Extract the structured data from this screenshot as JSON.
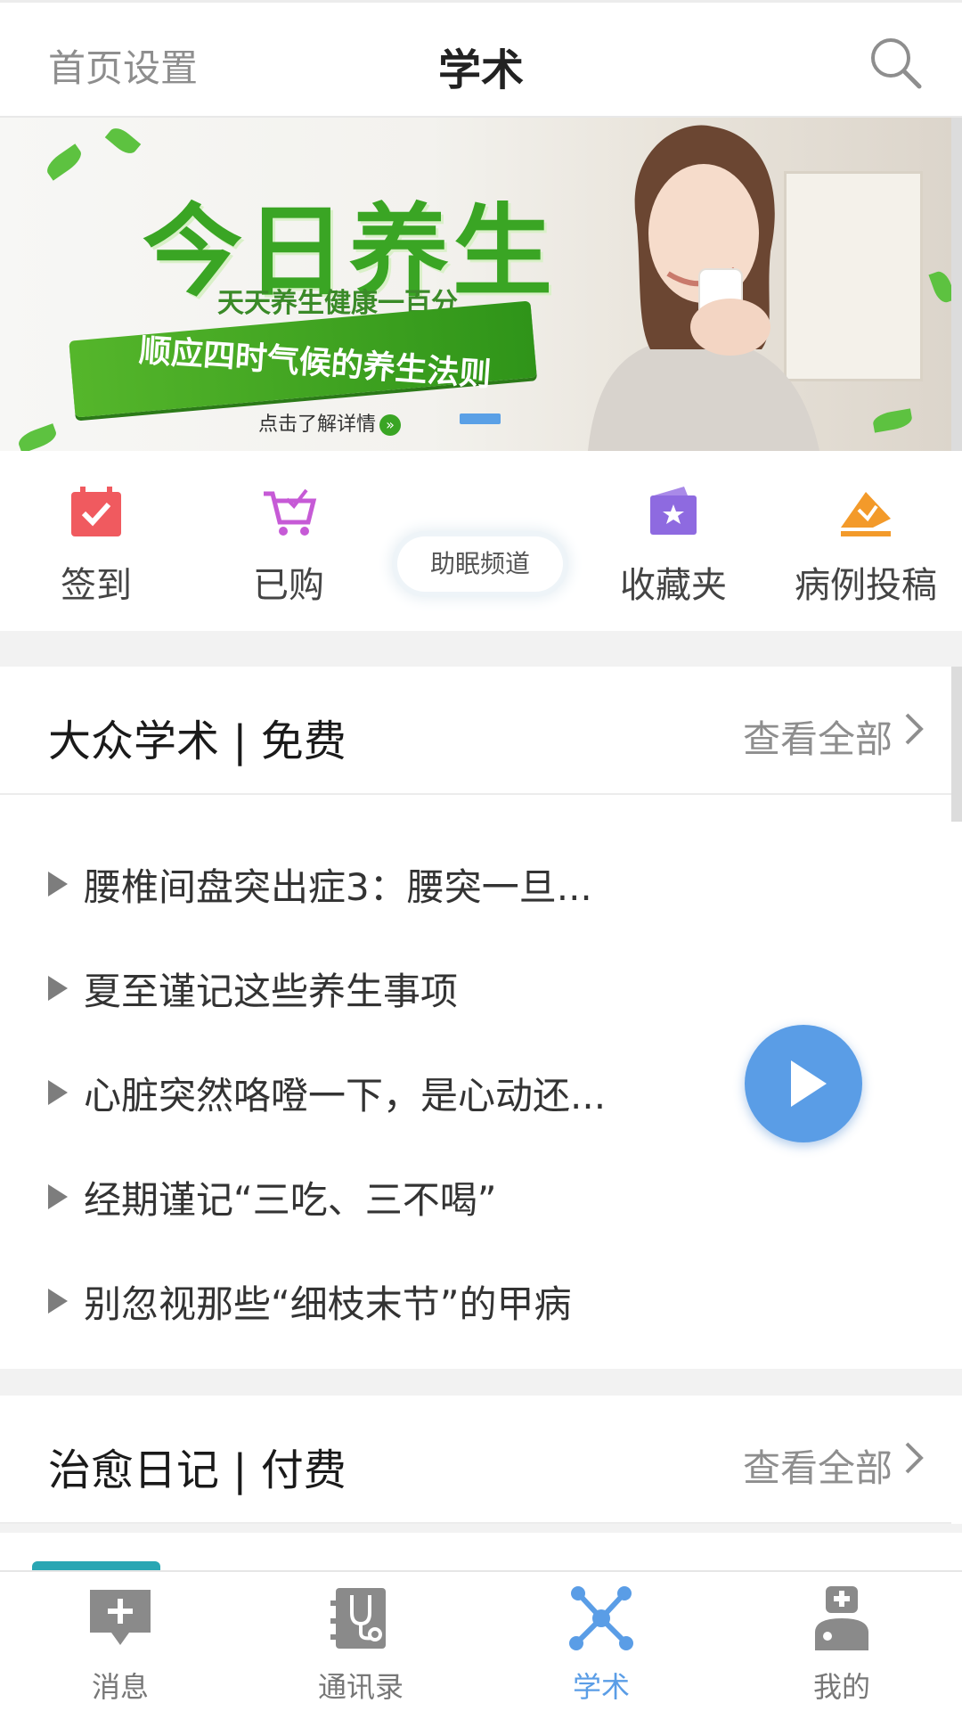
{
  "header": {
    "left_label": "首页设置",
    "title": "学术",
    "search_icon": "search-icon"
  },
  "banner": {
    "headline": "今日养生",
    "subtitle": "天天养生健康一百分",
    "ribbon_text": "顺应四时气候的养生法则",
    "detail_link": "点击了解详情",
    "active_slide_indicator": "1"
  },
  "quick_actions": [
    {
      "label": "签到",
      "icon": "calendar-check-icon",
      "color": "#f05a5f"
    },
    {
      "label": "已购",
      "icon": "cart-icon",
      "color": "#c65ad6"
    },
    {
      "label": "助眠频道",
      "icon": "cloud-badge"
    },
    {
      "label": "收藏夹",
      "icon": "folder-star-icon",
      "color": "#8e6ae0"
    },
    {
      "label": "病例投稿",
      "icon": "submit-case-icon",
      "color": "#f39a2a"
    }
  ],
  "public_section": {
    "title": "大众学术 | 免费",
    "more_label": "查看全部",
    "items": [
      "腰椎间盘突出症3：腰突一旦...",
      "夏至谨记这些养生事项",
      "心脏突然咯噔一下，是心动还...",
      "经期谨记“三吃、三不喝”",
      "别忽视那些“细枝末节”的甲病"
    ]
  },
  "diary_section": {
    "title": "治愈日记 | 付费",
    "more_label": "查看全部"
  },
  "bottom_nav": {
    "tabs": [
      {
        "label": "消息",
        "icon": "message-plus-icon"
      },
      {
        "label": "通讯录",
        "icon": "stethoscope-contacts-icon"
      },
      {
        "label": "学术",
        "icon": "molecule-icon"
      },
      {
        "label": "我的",
        "icon": "doctor-icon"
      }
    ],
    "active_tab": "学术"
  },
  "colors": {
    "accent": "#5a9de6",
    "banner_green": "#3aa524",
    "text_primary": "#1a1a1a",
    "text_secondary": "#8e8e8e"
  }
}
